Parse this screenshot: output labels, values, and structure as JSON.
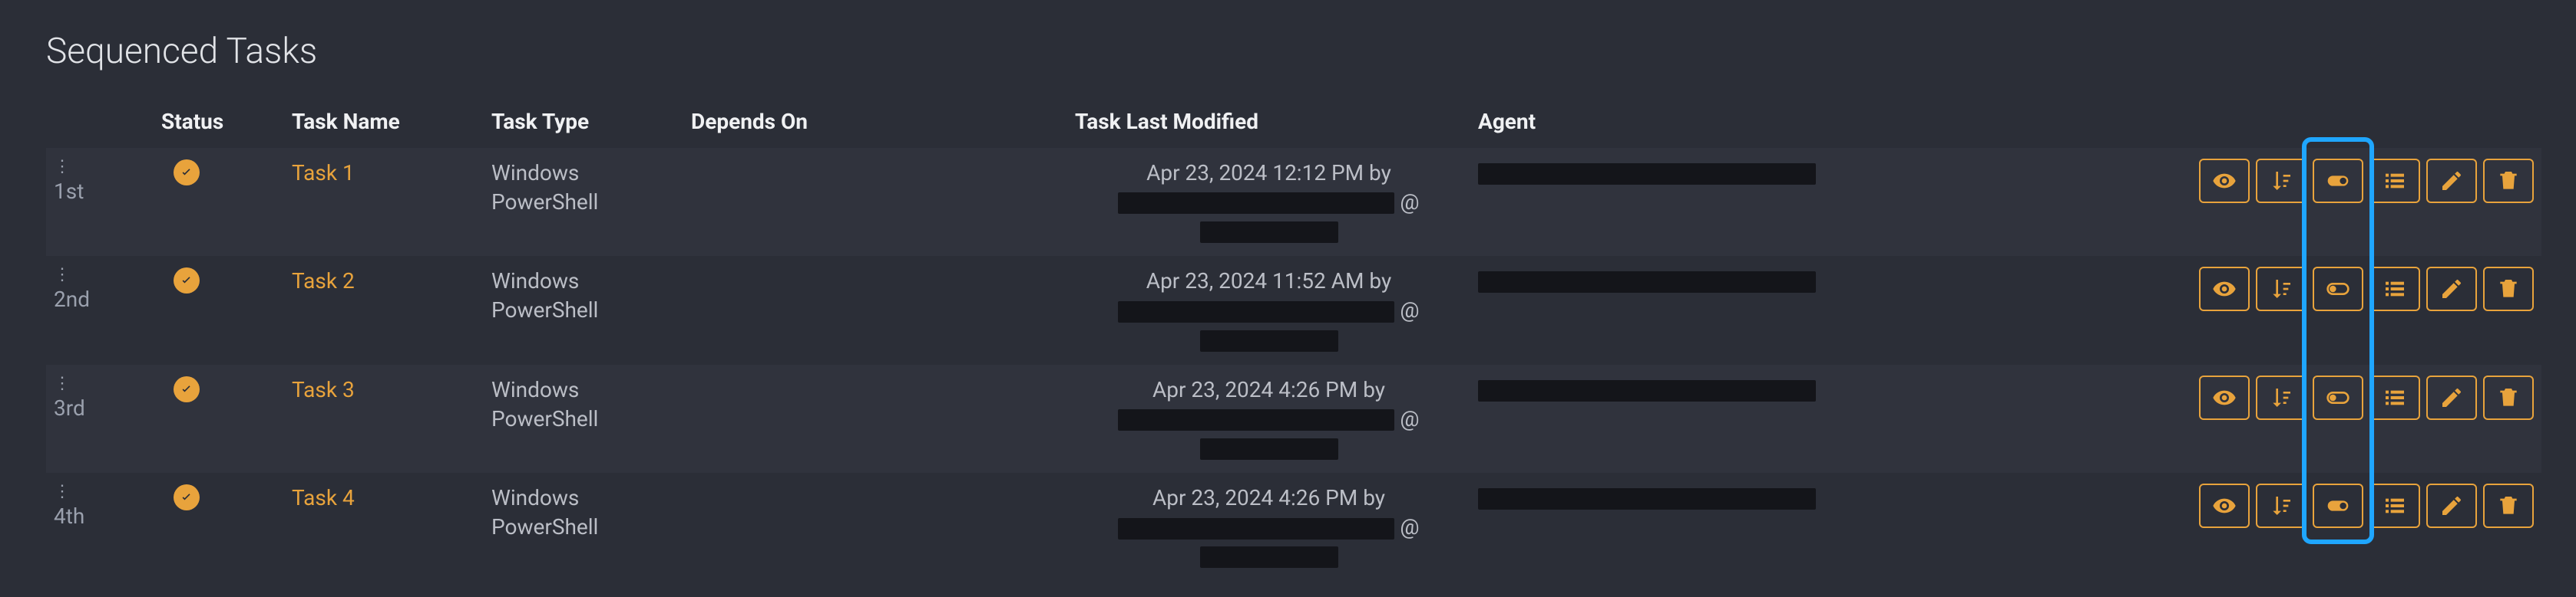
{
  "title": "Sequenced Tasks",
  "columns": {
    "status": "Status",
    "taskName": "Task Name",
    "taskType": "Task Type",
    "dependsOn": "Depends On",
    "lastModified": "Task Last Modified",
    "agent": "Agent"
  },
  "rows": [
    {
      "order": "1st",
      "name": "Task 1",
      "type": "Windows PowerShell",
      "lastModifiedPrefix": "Apr 23, 2024 12:12 PM by",
      "lastModifiedAt": "@",
      "toggleOn": true
    },
    {
      "order": "2nd",
      "name": "Task 2",
      "type": "Windows PowerShell",
      "lastModifiedPrefix": "Apr 23, 2024 11:52 AM by",
      "lastModifiedAt": "@",
      "toggleOn": false
    },
    {
      "order": "3rd",
      "name": "Task 3",
      "type": "Windows PowerShell",
      "lastModifiedPrefix": "Apr 23, 2024 4:26 PM by",
      "lastModifiedAt": "@",
      "toggleOn": false
    },
    {
      "order": "4th",
      "name": "Task 4",
      "type": "Windows PowerShell",
      "lastModifiedPrefix": "Apr 23, 2024 4:26 PM by",
      "lastModifiedAt": "@",
      "toggleOn": true
    }
  ],
  "actions": {
    "view": "view",
    "sort": "sort",
    "toggle": "toggle",
    "list": "list",
    "edit": "edit",
    "delete": "delete"
  }
}
